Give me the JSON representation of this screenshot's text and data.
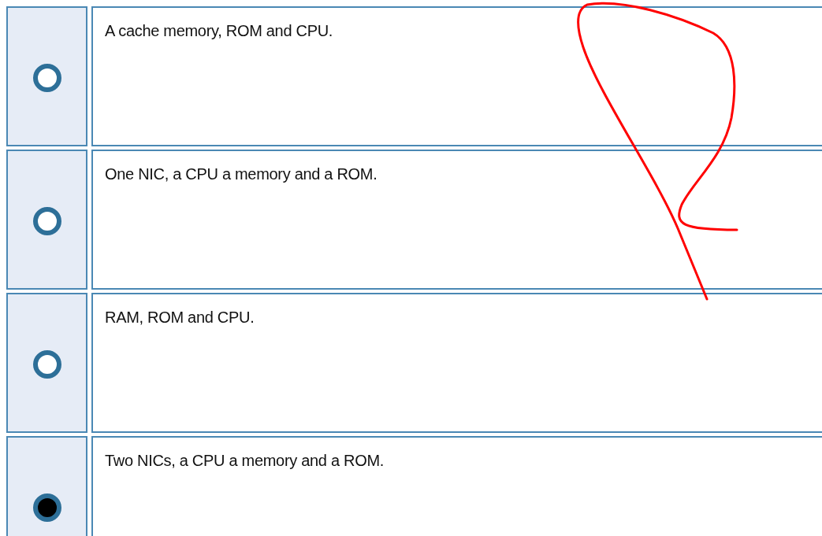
{
  "options": [
    {
      "text": "A cache memory, ROM and CPU.",
      "selected": false
    },
    {
      "text": "One NIC, a CPU a memory and a ROM.",
      "selected": false
    },
    {
      "text": "RAM, ROM and CPU.",
      "selected": false
    },
    {
      "text": "Two NICs, a CPU a memory and a ROM.",
      "selected": true
    }
  ]
}
